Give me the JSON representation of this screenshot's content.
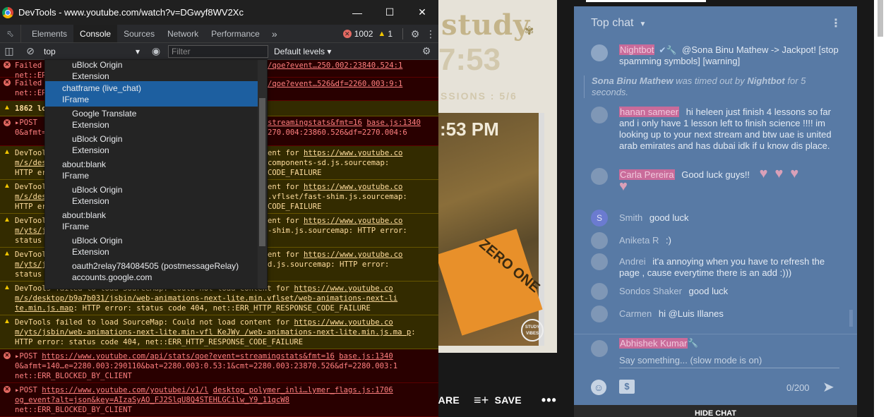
{
  "devtools": {
    "window_title": "DevTools - www.youtube.com/watch?v=DGwyf8WV2Xc",
    "tabs": [
      "Elements",
      "Console",
      "Sources",
      "Network",
      "Performance"
    ],
    "active_tab": "Console",
    "more_tabs": "»",
    "error_count": "1002",
    "warning_count": "1",
    "context": "top",
    "filter_placeholder": "Filter",
    "levels": "Default levels"
  },
  "console_messages": [
    {
      "type": "err",
      "text": "Failed ... /qoe?event…250.002:23840.524:1 net::ER"
    },
    {
      "type": "err",
      "text": "Failed ... /qoe?event…526&df=2260.003:9:1 net::ER"
    },
    {
      "type": "warn",
      "text": "1862 lo"
    },
    {
      "type": "err",
      "text": "POST ... streamingstats&fmt=16 base.js:1340 0&afmt= ... 270.004:23860.526&df=2270.004:6"
    },
    {
      "type": "warn",
      "text": "DevTools ... ent for https://www.youtube.co m/s/des ... components-sd.js.sourcemap: HTTP err ... CODE_FAILURE"
    },
    {
      "type": "warn",
      "text": "DevTools ... ent for https://www.youtube.co m/s/des ... vflset/fast-shim.js.sourcemap: HTTP err ... CODE_FAILURE"
    },
    {
      "type": "warn",
      "text": "DevTools ... ent for https://www.youtube.co m/yts/j ... -shim.js.sourcemap: HTTP error: status"
    },
    {
      "type": "warn",
      "text": "DevTools ... ent for https://www.youtube.co m/yts/j ... d.js.sourcemap: HTTP error: status"
    }
  ],
  "console_full": {
    "w1_line1": "DevTools failed to load SourceMap: Could not load content for ",
    "w1_link": "https://www.youtube.co m/s/desktop/b9a7b031/jsbin/web-animations-next-lite.min.vflset/web-animations-next-li te.min.js.map",
    "w1_tail": ": HTTP error: status code 404, net::ERR_HTTP_RESPONSE_CODE_FAILURE",
    "w2_line1": "DevTools failed to load SourceMap: Could not load content for ",
    "w2_link": "https://www.youtube.co m/yts/jsbin/web-animations-next-lite.min-vfl KeJWy /web-animations-next-lite.min.js.ma p",
    "w2_tail": ": HTTP error: status code 404, net::ERR_HTTP_RESPONSE_CODE_FAILURE",
    "e1_prefix": "POST ",
    "e1_link": "https://www.youtube.com/api/stats/qoe?event=streamingstats&fmt=16",
    "e1_src": "base.js:1340",
    "e1_rest": "0&afmt=140…e=2280.003:290110&bat=2280.003:0.53:1&cmt=2280.003:23870.526&df=2280.003:1",
    "e1_net": "net::ERR_BLOCKED_BY_CLIENT",
    "e2_prefix": "POST ",
    "e2_link": "https://www.youtube.com/youtubei/v1/l",
    "e2_src": "desktop_polymer_inli…lymer_flags.js:1706",
    "e2_rest": "og_event?alt=json&key=AIzaSyAO_FJ2SlqU8Q4STEHLGCilw_Y9_11qcW8",
    "e2_net": "net::ERR_BLOCKED_BY_CLIENT"
  },
  "context_menu": [
    {
      "title": "uBlock Origin",
      "kind": "Extension",
      "level": "sub"
    },
    {
      "title": "chatframe (live_chat)",
      "kind": "IFrame",
      "level": "top",
      "selected": true
    },
    {
      "title": "Google Translate",
      "kind": "Extension",
      "level": "sub"
    },
    {
      "title": "uBlock Origin",
      "kind": "Extension",
      "level": "sub"
    },
    {
      "title": "about:blank",
      "kind": "IFrame",
      "level": "top"
    },
    {
      "title": "uBlock Origin",
      "kind": "Extension",
      "level": "sub"
    },
    {
      "title": "about:blank",
      "kind": "IFrame",
      "level": "top"
    },
    {
      "title": "uBlock Origin",
      "kind": "Extension",
      "level": "sub"
    },
    {
      "title": "oauth2relay784084505 (postmessageRelay)",
      "kind": "accounts.google.com",
      "level": "sub"
    }
  ],
  "video": {
    "overlay_study": "study",
    "overlay_timer": "7:53",
    "overlay_sessions": "SSIONS : 5/6",
    "overlay_time": ":53 PM",
    "overlay_book": "ZERO ONE",
    "overlay_logo": "STUDY VIBES",
    "share_label": "HARE",
    "save_label": "SAVE",
    "more_label": "•••"
  },
  "chat": {
    "header_title": "Top chat",
    "messages": [
      {
        "author": "Nightbot",
        "mod": true,
        "text": "@Sona Binu Mathew -> Jackpot! [stop spamming symbols] [warning]"
      },
      {
        "system": "Sona Binu Mathew was timed out by Nightbot for 5 seconds."
      },
      {
        "author": "hanan sameer",
        "mod": true,
        "text": "hi heleen just finish 4 lessons so far and i only have 1 lesson left to finish science !!!! im looking up to your next stream and btw uae is united arab emirates and has dubai idk if u know dis place."
      },
      {
        "author": "Carla Pereira",
        "mod": true,
        "text": "Good luck guys!!"
      },
      {
        "author": "Smith",
        "text": "good luck"
      },
      {
        "author": "Aniketa R",
        "text": ":)"
      },
      {
        "author": "Andrei",
        "text": "it'a annoying when you have to refresh the page , cause everytime there is an add :)))"
      },
      {
        "author": "Sondos Shaker",
        "text": "good luck"
      },
      {
        "author": "Carmen",
        "text": "hi @Luis Illanes"
      }
    ],
    "smith_initial": "S",
    "sys_name1": "Sona Binu Mathew",
    "sys_mid": " was timed out by ",
    "sys_name2": "Nightbot",
    "sys_tail": " for 5 seconds.",
    "input_author": "Abhishek Kumar",
    "input_placeholder": "Say something... (slow mode is on)",
    "counter": "0/200",
    "hide_chat": "HIDE CHAT"
  }
}
